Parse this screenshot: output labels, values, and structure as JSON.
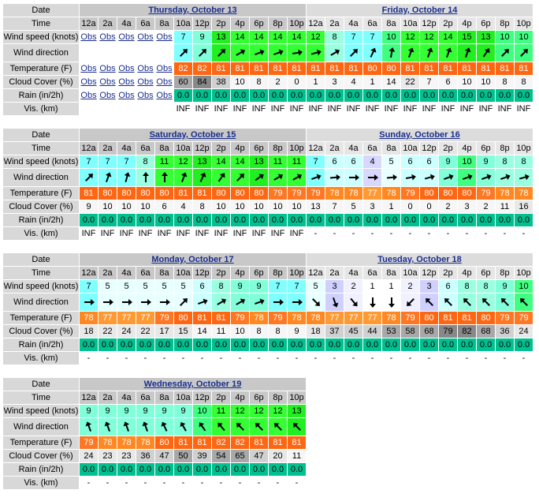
{
  "labels": {
    "date": "Date",
    "time": "Time",
    "wind_speed": "Wind speed (knots)",
    "wind_dir": "Wind direction",
    "temperature": "Temperature (F)",
    "cloud": "Cloud Cover (%)",
    "rain": "Rain (in/2h)",
    "vis": "Vis. (km)"
  },
  "obs_label": "Obs",
  "colors": {
    "speed": {
      "3": "#d0d0ff",
      "4": "#d8d8ff",
      "5": "#e8ffff",
      "6": "#ccffff",
      "7": "#80ffff",
      "8": "#99ffe0",
      "9": "#80ffd8",
      "10": "#40ff80",
      "11": "#33ff33",
      "12": "#33ff33",
      "13": "#22ee22",
      "14": "#33ff33",
      "15": "#22ee22",
      "1": "#ffffff",
      "2": "#f0f0ff"
    },
    "temp": {
      "77": "#ff9933",
      "78": "#ff8822",
      "79": "#ff7722",
      "80": "#ff6611",
      "81": "#ff6611",
      "82": "#ff6611",
      "84": "#ff5500"
    },
    "rain": "#00c090",
    "cloud_high": "#a8a8a8",
    "cloud_low": "#f4f4f4"
  },
  "blocks": [
    {
      "days": [
        {
          "label": "Thursday, October 13",
          "span": 12,
          "alt": false
        },
        {
          "label": "Friday, October 14",
          "span": 12,
          "alt": true
        }
      ],
      "times": [
        "12a",
        "2a",
        "4a",
        "6a",
        "8a",
        "10a",
        "12p",
        "2p",
        "4p",
        "6p",
        "8p",
        "10p",
        "12a",
        "2a",
        "4a",
        "6a",
        "8a",
        "10a",
        "12p",
        "2p",
        "4p",
        "6p",
        "8p",
        "10p"
      ],
      "obs_count": 5,
      "speed": [
        null,
        null,
        null,
        null,
        null,
        7,
        9,
        13,
        14,
        14,
        14,
        14,
        12,
        8,
        7,
        7,
        10,
        12,
        12,
        14,
        15,
        13,
        10,
        10
      ],
      "dir": [
        null,
        null,
        null,
        null,
        null,
        225,
        225,
        225,
        240,
        250,
        250,
        260,
        255,
        240,
        225,
        205,
        190,
        200,
        200,
        200,
        200,
        215,
        225,
        225
      ],
      "temp": [
        null,
        null,
        null,
        null,
        null,
        82,
        82,
        81,
        81,
        81,
        81,
        81,
        81,
        81,
        81,
        80,
        80,
        81,
        81,
        81,
        81,
        81,
        81,
        81
      ],
      "cloud": [
        null,
        null,
        null,
        null,
        null,
        60,
        84,
        38,
        10,
        8,
        2,
        0,
        1,
        3,
        4,
        1,
        14,
        22,
        7,
        6,
        10,
        10,
        8,
        8
      ],
      "rain": [
        null,
        null,
        null,
        null,
        null,
        "0.0",
        "0.0",
        "0.0",
        "0.0",
        "0.0",
        "0.0",
        "0.0",
        "0.0",
        "0.0",
        "0.0",
        "0.0",
        "0.0",
        "0.0",
        "0.0",
        "0.0",
        "0.0",
        "0.0",
        "0.0",
        "0.0"
      ],
      "vis": [
        "",
        "",
        "",
        "",
        "",
        "INF",
        "INF",
        "INF",
        "INF",
        "INF",
        "INF",
        "INF",
        "INF",
        "INF",
        "INF",
        "INF",
        "INF",
        "INF",
        "INF",
        "INF",
        "INF",
        "INF",
        "INF",
        "INF"
      ]
    },
    {
      "days": [
        {
          "label": "Saturday, October 15",
          "span": 12,
          "alt": false
        },
        {
          "label": "Sunday, October 16",
          "span": 12,
          "alt": true
        }
      ],
      "times": [
        "12a",
        "2a",
        "4a",
        "6a",
        "8a",
        "10a",
        "12p",
        "2p",
        "4p",
        "6p",
        "8p",
        "10p",
        "12a",
        "2a",
        "4a",
        "6a",
        "8a",
        "10a",
        "12p",
        "2p",
        "4p",
        "6p",
        "8p",
        "10p"
      ],
      "obs_count": 0,
      "speed": [
        7,
        7,
        7,
        8,
        11,
        12,
        13,
        14,
        14,
        13,
        11,
        11,
        7,
        6,
        6,
        4,
        5,
        6,
        6,
        9,
        10,
        9,
        8,
        8
      ],
      "dir": [
        225,
        200,
        195,
        180,
        180,
        200,
        205,
        215,
        225,
        235,
        240,
        240,
        250,
        265,
        270,
        270,
        265,
        260,
        255,
        250,
        250,
        250,
        250,
        255
      ],
      "temp": [
        81,
        80,
        80,
        80,
        80,
        81,
        81,
        80,
        80,
        80,
        79,
        79,
        79,
        78,
        78,
        77,
        78,
        79,
        80,
        80,
        80,
        79,
        78,
        78
      ],
      "cloud": [
        9,
        10,
        10,
        10,
        6,
        4,
        8,
        10,
        10,
        10,
        10,
        10,
        13,
        7,
        5,
        3,
        1,
        0,
        0,
        2,
        3,
        2,
        11,
        16
      ],
      "rain": [
        "0.0",
        "0.0",
        "0.0",
        "0.0",
        "0.0",
        "0.0",
        "0.0",
        "0.0",
        "0.0",
        "0.0",
        "0.0",
        "0.0",
        "0.0",
        "0.0",
        "0.0",
        "0.0",
        "0.0",
        "0.0",
        "0.0",
        "0.0",
        "0.0",
        "0.0",
        "0.0",
        "0.0"
      ],
      "vis": [
        "INF",
        "INF",
        "INF",
        "INF",
        "INF",
        "INF",
        "INF",
        "INF",
        "INF",
        "INF",
        "INF",
        "INF",
        "-",
        "-",
        "-",
        "-",
        "-",
        "-",
        "-",
        "-",
        "-",
        "-",
        "-",
        "-"
      ]
    },
    {
      "days": [
        {
          "label": "Monday, October 17",
          "span": 12,
          "alt": false
        },
        {
          "label": "Tuesday, October 18",
          "span": 12,
          "alt": true
        }
      ],
      "times": [
        "12a",
        "2a",
        "4a",
        "6a",
        "8a",
        "10a",
        "12p",
        "2p",
        "4p",
        "6p",
        "8p",
        "10p",
        "12a",
        "2a",
        "4a",
        "6a",
        "8a",
        "10a",
        "12p",
        "2p",
        "4p",
        "6p",
        "8p",
        "10p"
      ],
      "obs_count": 0,
      "speed": [
        7,
        5,
        5,
        5,
        5,
        5,
        6,
        8,
        9,
        9,
        7,
        7,
        5,
        3,
        2,
        1,
        1,
        2,
        3,
        6,
        8,
        8,
        9,
        10
      ],
      "dir": [
        270,
        270,
        270,
        270,
        270,
        225,
        250,
        240,
        240,
        250,
        270,
        270,
        315,
        340,
        320,
        0,
        0,
        45,
        135,
        135,
        135,
        135,
        135,
        135
      ],
      "temp": [
        78,
        77,
        77,
        77,
        79,
        80,
        81,
        81,
        79,
        78,
        79,
        78,
        78,
        77,
        77,
        77,
        78,
        79,
        80,
        81,
        81,
        80,
        79,
        79
      ],
      "cloud": [
        18,
        22,
        24,
        22,
        17,
        15,
        14,
        11,
        10,
        8,
        8,
        9,
        18,
        37,
        45,
        44,
        53,
        58,
        68,
        79,
        82,
        68,
        36,
        24
      ],
      "rain": [
        "0.0",
        "0.0",
        "0.0",
        "0.0",
        "0.0",
        "0.0",
        "0.0",
        "0.0",
        "0.0",
        "0.0",
        "0.0",
        "0.0",
        "0.0",
        "0.0",
        "0.0",
        "0.0",
        "0.0",
        "0.0",
        "0.0",
        "0.0",
        "0.0",
        "0.0",
        "0.0",
        "0.0"
      ],
      "vis": [
        "-",
        "-",
        "-",
        "-",
        "-",
        "-",
        "-",
        "-",
        "-",
        "-",
        "-",
        "-",
        "-",
        "-",
        "-",
        "-",
        "-",
        "-",
        "-",
        "-",
        "-",
        "-",
        "-",
        "-"
      ]
    },
    {
      "days": [
        {
          "label": "Wednesday, October 19",
          "span": 12,
          "alt": false
        }
      ],
      "times": [
        "12a",
        "2a",
        "4a",
        "6a",
        "8a",
        "10a",
        "12p",
        "2p",
        "4p",
        "6p",
        "8p",
        "10p"
      ],
      "obs_count": 0,
      "speed": [
        9,
        9,
        9,
        9,
        9,
        9,
        10,
        11,
        12,
        12,
        12,
        13
      ],
      "dir": [
        160,
        160,
        160,
        160,
        155,
        150,
        145,
        140,
        135,
        135,
        135,
        135
      ],
      "temp": [
        79,
        78,
        78,
        78,
        80,
        81,
        81,
        82,
        82,
        81,
        81,
        81
      ],
      "cloud": [
        24,
        23,
        23,
        36,
        47,
        50,
        39,
        54,
        65,
        47,
        20,
        11
      ],
      "rain": [
        "0.0",
        "0.0",
        "0.0",
        "0.0",
        "0.0",
        "0.0",
        "0.0",
        "0.0",
        "0.0",
        "0.0",
        "0.0",
        "0.0"
      ],
      "vis": [
        "-",
        "-",
        "-",
        "-",
        "-",
        "-",
        "-",
        "-",
        "-",
        "-",
        "-",
        "-"
      ]
    }
  ]
}
